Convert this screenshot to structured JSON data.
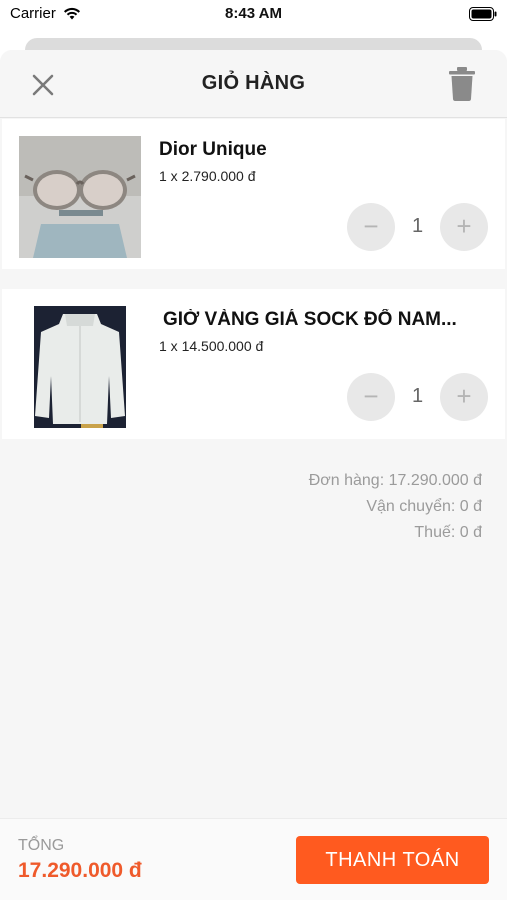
{
  "status_bar": {
    "carrier": "Carrier",
    "time": "8:43 AM"
  },
  "header": {
    "title": "GIỎ HÀNG",
    "close_icon": "close-icon",
    "trash_icon": "trash-icon"
  },
  "items": [
    {
      "name": "Dior Unique",
      "price_line": "1 x 2.790.000 đ",
      "quantity": "1",
      "minus_label": "−",
      "plus_label": "+"
    },
    {
      "name": "GIỜ VÀNG GIÁ SOCK ĐỔ NAM...",
      "price_line": "1 x 14.500.000 đ",
      "quantity": "1",
      "minus_label": "−",
      "plus_label": "+"
    }
  ],
  "summary": {
    "order": "Đơn hàng: 17.290.000 đ",
    "shipping": "Vận chuyển: 0 đ",
    "tax": "Thuế: 0 đ"
  },
  "footer": {
    "total_label": "TỔNG",
    "total_value": "17.290.000 đ",
    "checkout_label": "THANH TOÁN"
  },
  "colors": {
    "accent": "#ff5a1f",
    "total_text": "#ef5a2b",
    "qty_button_bg": "#e8e8e8"
  }
}
